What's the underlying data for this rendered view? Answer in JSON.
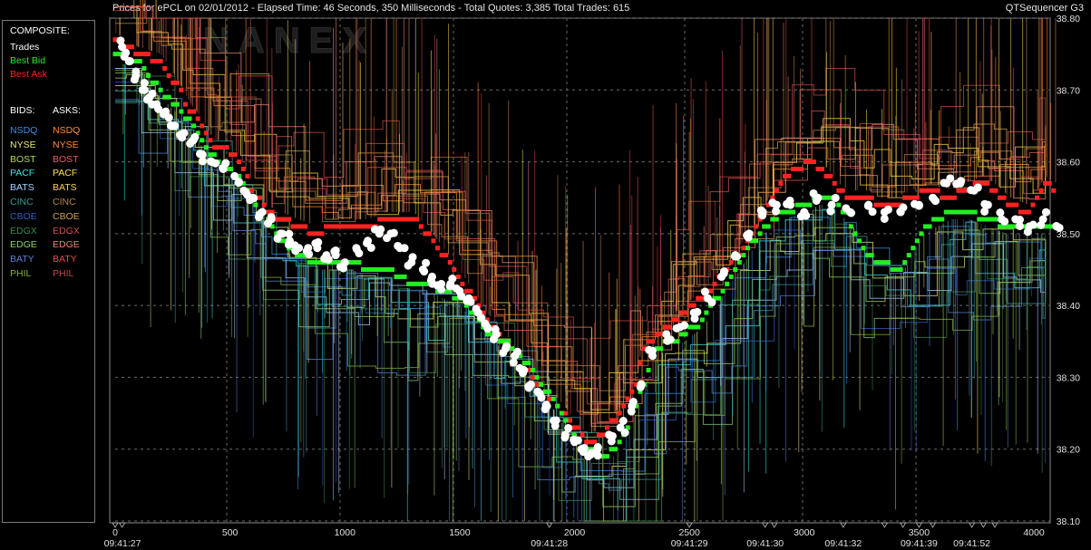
{
  "header": {
    "title": "Prices for  ePCL  on  02/01/2012  -  Elapsed Time: 46 Seconds, 350 Milliseconds  -  Total Quotes: 3,385  Total Trades: 615",
    "app_name": "QTSequencer G3"
  },
  "watermark": "NANEX",
  "legend": {
    "composite_label": "COMPOSITE:",
    "composite_items": [
      {
        "label": "Trades",
        "color": "#ffffff"
      },
      {
        "label": "Best Bid",
        "color": "#22ee22"
      },
      {
        "label": "Best Ask",
        "color": "#ff2222"
      }
    ],
    "bids_label": "BIDS:",
    "asks_label": "ASKS:",
    "exchanges": [
      {
        "bid": "NSDQ",
        "ask": "NSDQ",
        "bid_color": "#3f8fe6",
        "ask_color": "#ff8c3a"
      },
      {
        "bid": "NYSE",
        "ask": "NYSE",
        "bid_color": "#e8e87a",
        "ask_color": "#ff8c3a"
      },
      {
        "bid": "BOST",
        "ask": "BOST",
        "bid_color": "#b0d860",
        "ask_color": "#e06060"
      },
      {
        "bid": "PACF",
        "ask": "PACF",
        "bid_color": "#40e0e0",
        "ask_color": "#ffe050"
      },
      {
        "bid": "BATS",
        "ask": "BATS",
        "bid_color": "#a8d0ff",
        "ask_color": "#ffcc55"
      },
      {
        "bid": "CINC",
        "ask": "CINC",
        "bid_color": "#3a9a9a",
        "ask_color": "#b88a4a"
      },
      {
        "bid": "CBOE",
        "ask": "CBOE",
        "bid_color": "#2e5fc0",
        "ask_color": "#d0a050"
      },
      {
        "bid": "EDGX",
        "ask": "EDGX",
        "bid_color": "#3a8a4a",
        "ask_color": "#d05050"
      },
      {
        "bid": "EDGE",
        "ask": "EDGE",
        "bid_color": "#8ad070",
        "ask_color": "#e88a70"
      },
      {
        "bid": "BATY",
        "ask": "BATY",
        "bid_color": "#5a80d0",
        "ask_color": "#e05050"
      },
      {
        "bid": "PHIL",
        "ask": "PHIL",
        "bid_color": "#86b040",
        "ask_color": "#c84848"
      }
    ]
  },
  "chart_data": {
    "type": "line",
    "ylim": [
      38.1,
      38.8
    ],
    "xlim": [
      0,
      4000
    ],
    "y_ticks": [
      "38.80",
      "38.70",
      "38.60",
      "38.50",
      "38.40",
      "38.30",
      "38.20",
      "38.10"
    ],
    "x_ticks": [
      {
        "x": 0,
        "label": "0"
      },
      {
        "x": 500,
        "label": "500"
      },
      {
        "x": 1000,
        "label": "1000"
      },
      {
        "x": 1500,
        "label": "1500"
      },
      {
        "x": 2000,
        "label": "2000"
      },
      {
        "x": 2500,
        "label": "2500"
      },
      {
        "x": 3000,
        "label": "3000"
      },
      {
        "x": 3500,
        "label": "3500"
      },
      {
        "x": 4000,
        "label": "4000"
      }
    ],
    "time_labels": [
      {
        "x": 0,
        "label": "09:41:27"
      },
      {
        "x": 1890,
        "label": "09:41:28"
      },
      {
        "x": 2500,
        "label": "09:41:29"
      },
      {
        "x": 2830,
        "label": "09:41:30"
      },
      {
        "x": 3170,
        "label": "09:41:32"
      },
      {
        "x": 3500,
        "label": "09:41:39"
      },
      {
        "x": 3730,
        "label": "09:41:52"
      }
    ],
    "series": [
      {
        "name": "Best Ask",
        "color": "#ff2222",
        "points": [
          [
            0,
            38.77
          ],
          [
            100,
            38.75
          ],
          [
            200,
            38.74
          ],
          [
            280,
            38.7
          ],
          [
            330,
            38.67
          ],
          [
            380,
            38.65
          ],
          [
            430,
            38.62
          ],
          [
            480,
            38.62
          ],
          [
            540,
            38.6
          ],
          [
            600,
            38.56
          ],
          [
            660,
            38.53
          ],
          [
            720,
            38.52
          ],
          [
            800,
            38.51
          ],
          [
            880,
            38.5
          ],
          [
            950,
            38.51
          ],
          [
            1030,
            38.51
          ],
          [
            1100,
            38.51
          ],
          [
            1180,
            38.52
          ],
          [
            1230,
            38.52
          ],
          [
            1300,
            38.52
          ],
          [
            1360,
            38.5
          ],
          [
            1430,
            38.47
          ],
          [
            1500,
            38.44
          ],
          [
            1560,
            38.41
          ],
          [
            1620,
            38.38
          ],
          [
            1700,
            38.35
          ],
          [
            1760,
            38.33
          ],
          [
            1820,
            38.3
          ],
          [
            1870,
            38.28
          ],
          [
            1930,
            38.26
          ],
          [
            1980,
            38.24
          ],
          [
            2030,
            38.22
          ],
          [
            2060,
            38.21
          ],
          [
            2120,
            38.22
          ],
          [
            2200,
            38.25
          ],
          [
            2260,
            38.28
          ],
          [
            2300,
            38.34
          ],
          [
            2400,
            38.37
          ],
          [
            2470,
            38.39
          ],
          [
            2560,
            38.41
          ],
          [
            2660,
            38.45
          ],
          [
            2760,
            38.49
          ],
          [
            2830,
            38.53
          ],
          [
            2890,
            38.57
          ],
          [
            2960,
            38.59
          ],
          [
            3030,
            38.6
          ],
          [
            3080,
            38.59
          ],
          [
            3150,
            38.56
          ],
          [
            3200,
            38.55
          ],
          [
            3280,
            38.55
          ],
          [
            3330,
            38.54
          ],
          [
            3400,
            38.54
          ],
          [
            3470,
            38.55
          ],
          [
            3550,
            38.56
          ],
          [
            3620,
            38.55
          ],
          [
            3700,
            38.56
          ],
          [
            3780,
            38.57
          ],
          [
            3830,
            38.56
          ],
          [
            3900,
            38.54
          ],
          [
            3980,
            38.53
          ],
          [
            4050,
            38.57
          ],
          [
            4100,
            38.56
          ]
        ]
      },
      {
        "name": "Best Bid",
        "color": "#22ee22",
        "points": [
          [
            0,
            38.75
          ],
          [
            100,
            38.74
          ],
          [
            170,
            38.71
          ],
          [
            230,
            38.69
          ],
          [
            290,
            38.67
          ],
          [
            360,
            38.64
          ],
          [
            420,
            38.61
          ],
          [
            480,
            38.59
          ],
          [
            540,
            38.58
          ],
          [
            600,
            38.55
          ],
          [
            660,
            38.52
          ],
          [
            720,
            38.49
          ],
          [
            800,
            38.47
          ],
          [
            880,
            38.46
          ],
          [
            950,
            38.46
          ],
          [
            1030,
            38.46
          ],
          [
            1100,
            38.45
          ],
          [
            1180,
            38.45
          ],
          [
            1240,
            38.44
          ],
          [
            1300,
            38.43
          ],
          [
            1360,
            38.43
          ],
          [
            1430,
            38.42
          ],
          [
            1500,
            38.41
          ],
          [
            1560,
            38.39
          ],
          [
            1620,
            38.36
          ],
          [
            1700,
            38.35
          ],
          [
            1760,
            38.33
          ],
          [
            1820,
            38.31
          ],
          [
            1880,
            38.28
          ],
          [
            1940,
            38.25
          ],
          [
            1990,
            38.22
          ],
          [
            2040,
            38.2
          ],
          [
            2140,
            38.19
          ],
          [
            2200,
            38.21
          ],
          [
            2240,
            38.24
          ],
          [
            2290,
            38.28
          ],
          [
            2320,
            38.31
          ],
          [
            2360,
            38.34
          ],
          [
            2420,
            38.35
          ],
          [
            2480,
            38.36
          ],
          [
            2560,
            38.38
          ],
          [
            2660,
            38.43
          ],
          [
            2740,
            38.47
          ],
          [
            2800,
            38.5
          ],
          [
            2860,
            38.52
          ],
          [
            2910,
            38.53
          ],
          [
            3000,
            38.54
          ],
          [
            3070,
            38.55
          ],
          [
            3120,
            38.55
          ],
          [
            3180,
            38.53
          ],
          [
            3220,
            38.5
          ],
          [
            3280,
            38.47
          ],
          [
            3340,
            38.46
          ],
          [
            3420,
            38.45
          ],
          [
            3470,
            38.48
          ],
          [
            3520,
            38.51
          ],
          [
            3580,
            38.52
          ],
          [
            3640,
            38.53
          ],
          [
            3720,
            38.53
          ],
          [
            3800,
            38.52
          ],
          [
            3880,
            38.51
          ],
          [
            3950,
            38.51
          ],
          [
            4020,
            38.51
          ],
          [
            4100,
            38.51
          ]
        ]
      },
      {
        "name": "Trades",
        "color": "#ffffff",
        "points": [
          [
            30,
            38.76
          ],
          [
            60,
            38.74
          ],
          [
            90,
            38.72
          ],
          [
            120,
            38.7
          ],
          [
            150,
            38.69
          ],
          [
            180,
            38.68
          ],
          [
            220,
            38.67
          ],
          [
            260,
            38.65
          ],
          [
            300,
            38.64
          ],
          [
            340,
            38.63
          ],
          [
            380,
            38.61
          ],
          [
            420,
            38.6
          ],
          [
            470,
            38.59
          ],
          [
            520,
            38.58
          ],
          [
            560,
            38.56
          ],
          [
            600,
            38.55
          ],
          [
            640,
            38.53
          ],
          [
            680,
            38.52
          ],
          [
            720,
            38.5
          ],
          [
            760,
            38.49
          ],
          [
            800,
            38.48
          ],
          [
            840,
            38.48
          ],
          [
            880,
            38.48
          ],
          [
            920,
            38.47
          ],
          [
            960,
            38.47
          ],
          [
            1000,
            38.46
          ],
          [
            1050,
            38.48
          ],
          [
            1100,
            38.49
          ],
          [
            1150,
            38.5
          ],
          [
            1200,
            38.5
          ],
          [
            1240,
            38.48
          ],
          [
            1290,
            38.46
          ],
          [
            1340,
            38.45
          ],
          [
            1380,
            38.44
          ],
          [
            1420,
            38.43
          ],
          [
            1460,
            38.43
          ],
          [
            1500,
            38.42
          ],
          [
            1540,
            38.41
          ],
          [
            1580,
            38.39
          ],
          [
            1620,
            38.37
          ],
          [
            1660,
            38.36
          ],
          [
            1700,
            38.34
          ],
          [
            1740,
            38.33
          ],
          [
            1780,
            38.31
          ],
          [
            1810,
            38.29
          ],
          [
            1840,
            38.28
          ],
          [
            1880,
            38.26
          ],
          [
            1920,
            38.24
          ],
          [
            1960,
            38.22
          ],
          [
            2000,
            38.21
          ],
          [
            2030,
            38.2
          ],
          [
            2060,
            38.19
          ],
          [
            2100,
            38.2
          ],
          [
            2150,
            38.22
          ],
          [
            2200,
            38.23
          ],
          [
            2250,
            38.26
          ],
          [
            2290,
            38.29
          ],
          [
            2340,
            38.33
          ],
          [
            2400,
            38.36
          ],
          [
            2460,
            38.37
          ],
          [
            2520,
            38.39
          ],
          [
            2580,
            38.41
          ],
          [
            2640,
            38.44
          ],
          [
            2700,
            38.47
          ],
          [
            2760,
            38.5
          ],
          [
            2820,
            38.53
          ],
          [
            2880,
            38.54
          ],
          [
            2940,
            38.54
          ],
          [
            3000,
            38.53
          ],
          [
            3060,
            38.55
          ],
          [
            3120,
            38.54
          ],
          [
            3200,
            38.53
          ],
          [
            3280,
            38.54
          ],
          [
            3350,
            38.53
          ],
          [
            3420,
            38.53
          ],
          [
            3500,
            38.54
          ],
          [
            3560,
            38.55
          ],
          [
            3620,
            38.57
          ],
          [
            3680,
            38.57
          ],
          [
            3740,
            38.56
          ],
          [
            3800,
            38.54
          ],
          [
            3860,
            38.52
          ],
          [
            3920,
            38.52
          ],
          [
            3980,
            38.51
          ],
          [
            4040,
            38.52
          ],
          [
            4100,
            38.51
          ]
        ]
      }
    ]
  }
}
